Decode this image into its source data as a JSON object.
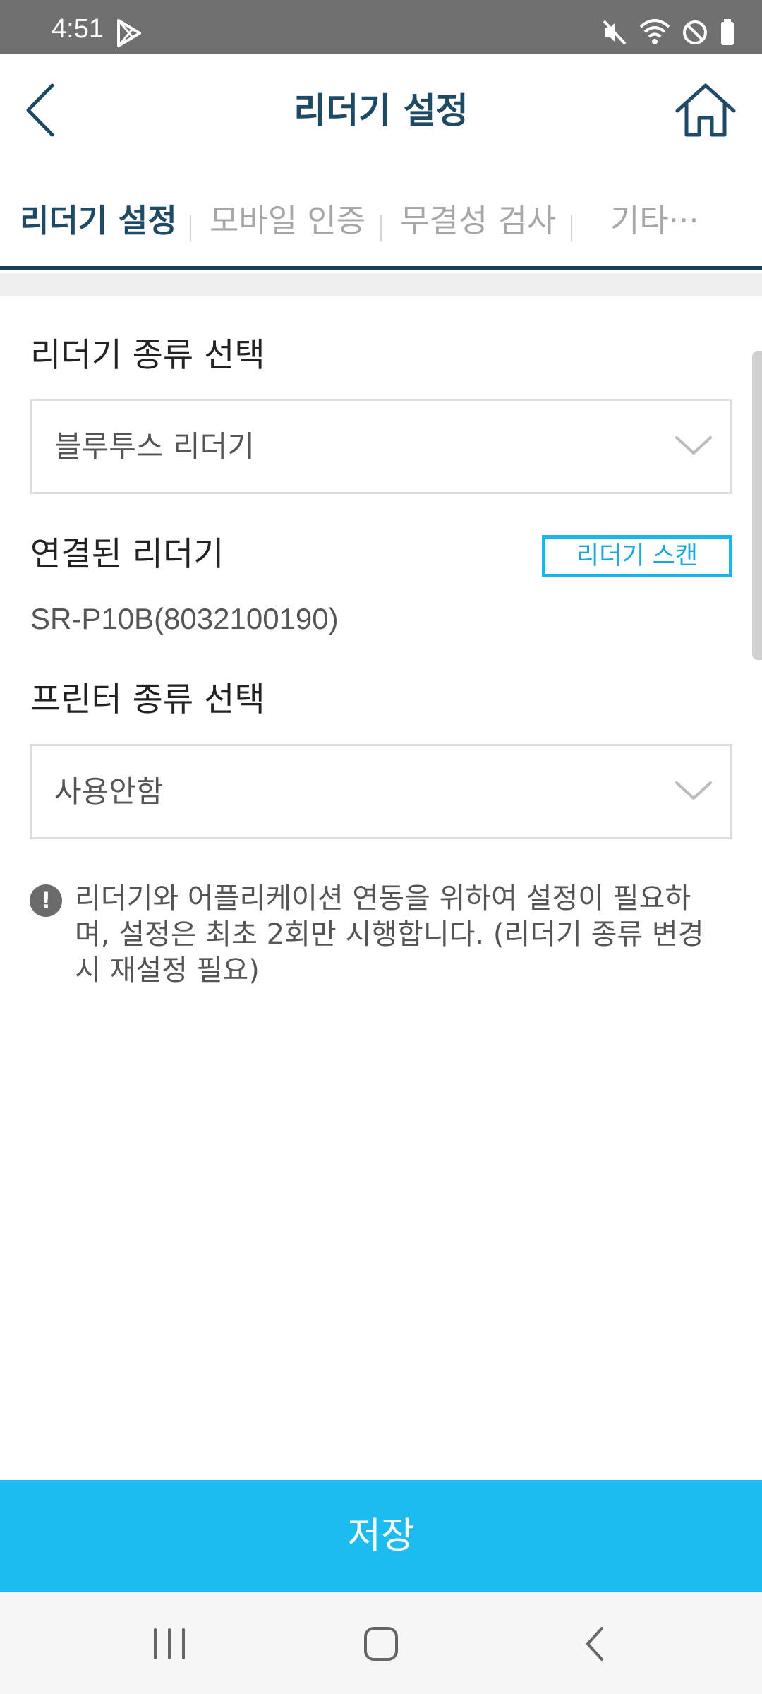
{
  "status_bar": {
    "time": "4:51",
    "icons": [
      "play-store-icon",
      "mute-icon",
      "wifi-icon",
      "do-not-disturb-icon",
      "battery-icon"
    ]
  },
  "header": {
    "title": "리더기 설정",
    "back_icon": "chevron-left-icon",
    "home_icon": "home-icon"
  },
  "tabs": [
    {
      "label": "리더기 설정",
      "active": true
    },
    {
      "label": "모바일 인증",
      "active": false
    },
    {
      "label": "무결성 검사",
      "active": false
    },
    {
      "label": "기타···",
      "active": false
    }
  ],
  "reader_type": {
    "label": "리더기 종류 선택",
    "selected": "블루투스 리더기"
  },
  "connected_reader": {
    "label": "연결된 리더기",
    "scan_button": "리더기 스캔",
    "value": "SR-P10B(8032100190)"
  },
  "printer_type": {
    "label": "프린터 종류 선택",
    "selected": "사용안함"
  },
  "notice": {
    "icon": "exclamation-icon",
    "text": "리더기와 어플리케이션 연동을 위하여 설정이 필요하며, 설정은 최초 2회만 시행합니다. (리더기 종류 변경시 재설정 필요)"
  },
  "save_button": "저장",
  "colors": {
    "accent": "#1cbcee",
    "title": "#1e4a66",
    "status_bar": "#707070",
    "inactive_tab": "#a7a7a7"
  }
}
